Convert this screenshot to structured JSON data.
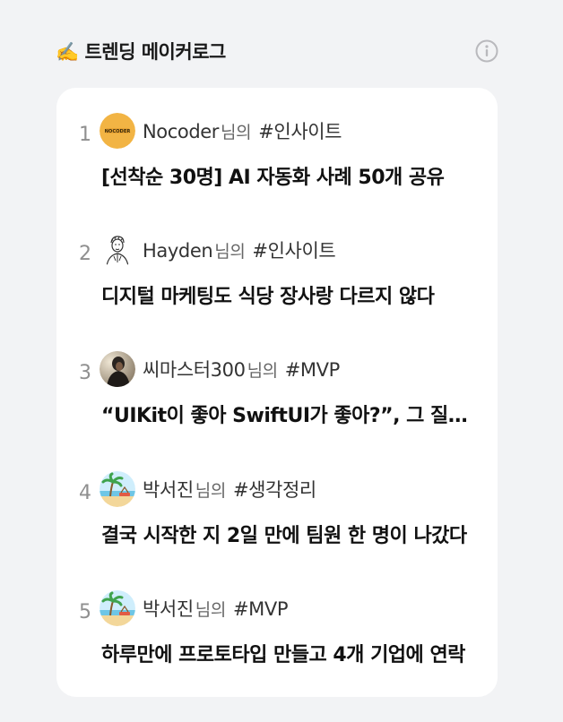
{
  "header": {
    "title": "✍️ 트렌딩 메이커로그",
    "info_icon": "info-circle-icon"
  },
  "colors": {
    "background": "#f2f3f5",
    "card": "#ffffff",
    "rank": "#8f8f8f",
    "text": "#111111"
  },
  "items": [
    {
      "rank": "1",
      "author": "Nocoder",
      "suffix": "님의",
      "tag": "#인사이트",
      "title": "[선착순 30명] AI 자동화 사례 50개 공유",
      "avatar": "nocoder-logo-avatar"
    },
    {
      "rank": "2",
      "author": "Hayden",
      "suffix": "님의",
      "tag": "#인사이트",
      "title": "디지털 마케팅도 식당 장사랑 다르지 않다",
      "avatar": "sketch-person-avatar"
    },
    {
      "rank": "3",
      "author": "씨마스터300",
      "suffix": "님의",
      "tag": "#MVP",
      "title": "“UIKit이 좋아 SwiftUI가 좋아?”, 그 질문에 대하여",
      "avatar": "photo-person-avatar"
    },
    {
      "rank": "4",
      "author": "박서진",
      "suffix": "님의",
      "tag": "#생각정리",
      "title": "결국 시작한 지 2일 만에 팀원 한 명이 나갔다",
      "avatar": "beach-avatar"
    },
    {
      "rank": "5",
      "author": "박서진",
      "suffix": "님의",
      "tag": "#MVP",
      "title": "하루만에 프로토타입 만들고 4개 기업에 연락",
      "avatar": "beach-avatar"
    }
  ]
}
